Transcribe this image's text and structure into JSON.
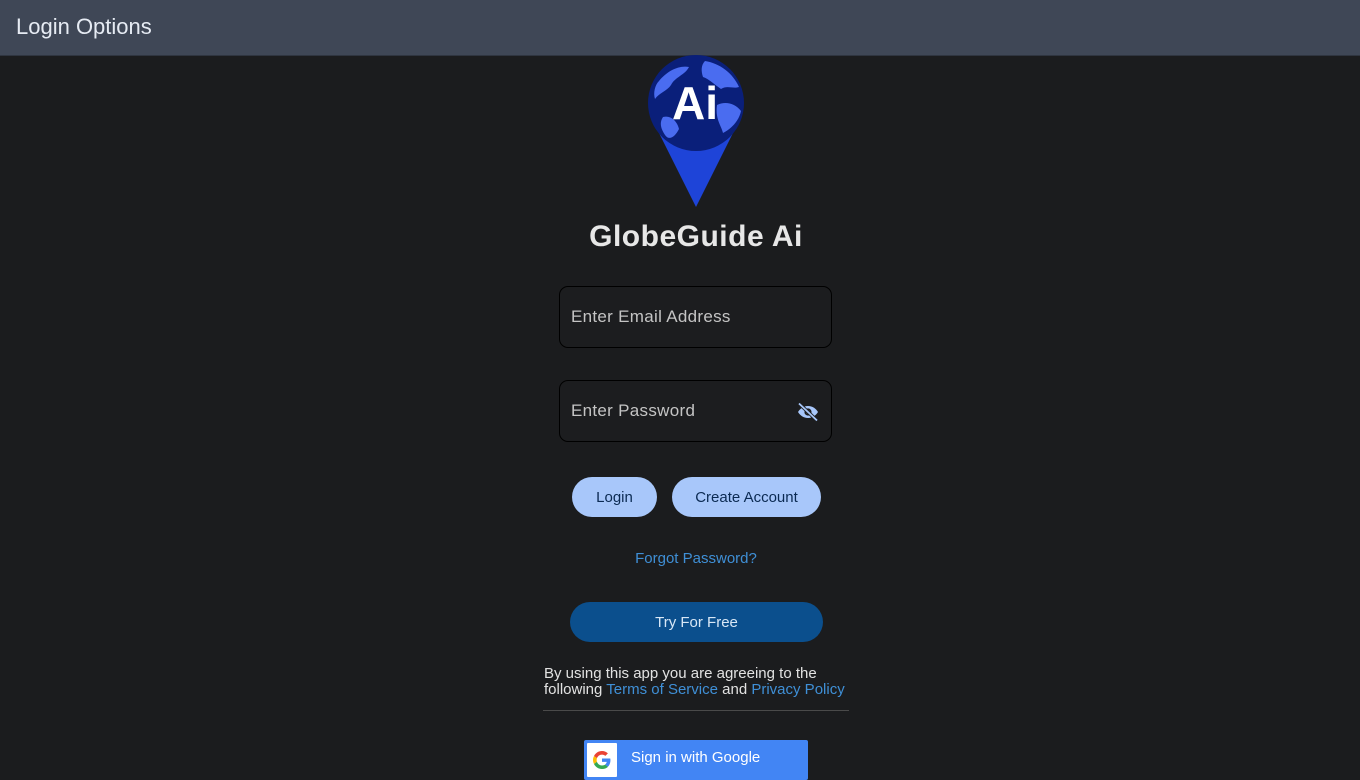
{
  "header": {
    "title": "Login Options"
  },
  "brand": {
    "logo_icon": "globe-location-pin-icon",
    "logo_text": "Ai",
    "app_name": "GlobeGuide Ai"
  },
  "form": {
    "email": {
      "value": "",
      "placeholder": "Enter Email Address"
    },
    "password": {
      "value": "",
      "placeholder": "Enter Password",
      "toggle_icon": "eye-off-icon"
    }
  },
  "actions": {
    "login_label": "Login",
    "create_account_label": "Create Account",
    "forgot_password_label": "Forgot Password?",
    "try_free_label": "Try For Free"
  },
  "terms": {
    "prefix": "By using this app you are agreeing to the following ",
    "terms_link": "Terms of Service",
    "conjunction": " and ",
    "privacy_link": "Privacy Policy"
  },
  "google": {
    "icon": "google-g-icon",
    "label": "Sign in with Google"
  },
  "colors": {
    "header_bg": "#3f4756",
    "page_bg": "#1b1c1e",
    "pill_button": "#a8c7fa",
    "primary_button": "#0b4f8d",
    "link": "#3f8fd6",
    "google_blue": "#4285f4"
  }
}
